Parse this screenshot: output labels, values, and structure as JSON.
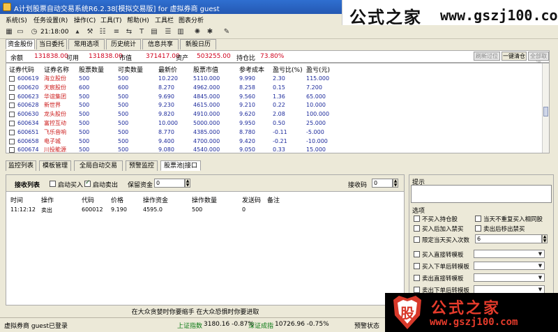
{
  "window": {
    "title": "A计划股票自动交易系统R6.2.38[模拟交易版] for 虚拟券商 guest"
  },
  "watermark_top": {
    "zh": "公式之家",
    "url": "www.gszj100.com"
  },
  "menu": [
    "系统(S)",
    "任务设置(R)",
    "操作(C)",
    "工具(T)",
    "帮助(H)",
    "工具栏",
    "图表分析"
  ],
  "toolbar": {
    "time": "21:18:00"
  },
  "tabs_top": [
    "资金股份",
    "当日委托",
    "常用选项",
    "历史统计",
    "信息共享",
    "新股日历"
  ],
  "summary": {
    "balance_label": "余额",
    "balance": "131838.00",
    "available_label": "可用",
    "available": "131838.00",
    "market_value_label": "市值",
    "market_value": "371417.00",
    "assets_label": "资产",
    "assets": "503255.00",
    "position_ratio_label": "持仓比",
    "position_ratio": "73.80%",
    "btn_refresh": "刷新过位",
    "btn_clear": "一键清仓",
    "btn_select_all": "全部取消"
  },
  "stock_table": {
    "headers": [
      "证券代码",
      "证券名称",
      "股票数量",
      "可卖数量",
      "最新价",
      "股票市值",
      "参考成本",
      "盈亏比(%)",
      "盈亏(元)"
    ],
    "rows": [
      {
        "code": "600619",
        "name": "海立股份",
        "qty": "500",
        "avail": "500",
        "price": "10.220",
        "mv": "5110.000",
        "cost": "9.990",
        "pct": "2.30",
        "pl": "115.000"
      },
      {
        "code": "600620",
        "name": "天宸股份",
        "qty": "600",
        "avail": "600",
        "price": "8.270",
        "mv": "4962.000",
        "cost": "8.258",
        "pct": "0.15",
        "pl": "7.200"
      },
      {
        "code": "600623",
        "name": "华谊集团",
        "qty": "500",
        "avail": "500",
        "price": "9.690",
        "mv": "4845.000",
        "cost": "9.560",
        "pct": "1.36",
        "pl": "65.000"
      },
      {
        "code": "600628",
        "name": "新世界",
        "qty": "500",
        "avail": "500",
        "price": "9.230",
        "mv": "4615.000",
        "cost": "9.210",
        "pct": "0.22",
        "pl": "10.000"
      },
      {
        "code": "600630",
        "name": "龙头股份",
        "qty": "500",
        "avail": "500",
        "price": "9.820",
        "mv": "4910.000",
        "cost": "9.620",
        "pct": "2.08",
        "pl": "100.000"
      },
      {
        "code": "600634",
        "name": "富控互动",
        "qty": "500",
        "avail": "500",
        "price": "10.000",
        "mv": "5000.000",
        "cost": "9.950",
        "pct": "0.50",
        "pl": "25.000"
      },
      {
        "code": "600651",
        "name": "飞乐音响",
        "qty": "500",
        "avail": "500",
        "price": "8.770",
        "mv": "4385.000",
        "cost": "8.780",
        "pct": "-0.11",
        "pl": "-5.000"
      },
      {
        "code": "600658",
        "name": "电子城",
        "qty": "500",
        "avail": "500",
        "price": "9.400",
        "mv": "4700.000",
        "cost": "9.420",
        "pct": "-0.21",
        "pl": "-10.000"
      },
      {
        "code": "600674",
        "name": "川投能源",
        "qty": "500",
        "avail": "500",
        "price": "9.080",
        "mv": "4540.000",
        "cost": "9.050",
        "pct": "0.33",
        "pl": "15.000"
      }
    ]
  },
  "tabs_mid": [
    "监控列表",
    "模板管理",
    "全局自动交易",
    "预警监控",
    "股票池|接口"
  ],
  "receive": {
    "title": "接收列表",
    "auto_buy": "启动买入",
    "auto_sell": "启动卖出",
    "reserve_label": "保留资金",
    "reserve_value": "0",
    "recv_code_label": "接收码",
    "recv_code_value": "0",
    "headers": [
      "时间",
      "操作",
      "代码",
      "价格",
      "操作资金",
      "操作数量",
      "发送码",
      "备注"
    ],
    "row": {
      "time": "11:12:12",
      "op": "卖出",
      "code": "600012",
      "price": "9.190",
      "fund": "4595.0",
      "qty": "500",
      "send": "0",
      "note": ""
    }
  },
  "tips": {
    "title": "提示",
    "options_title": "选项",
    "opt_no_buy_held": "不买入持仓股",
    "opt_no_repeat": "当天不重复买入相同股",
    "opt_forbid_after_buy": "买入后加入禁买",
    "opt_forbid_after_sell": "卖出后移出禁买",
    "opt_limit_label": "限定当天买入次数",
    "opt_limit_value": "6",
    "opt_buy_template": "买入直接转模板",
    "opt_buy_after_order": "买入下单后转模板",
    "opt_sell_template": "卖出直接转模板",
    "opt_sell_after_order": "卖出下单后转模板"
  },
  "marquee": "在大众贪婪时你要缩手 在大众恐惧时你要进取",
  "status": {
    "broker": "虚拟券商 guest已登录",
    "sh_label": "上证指数",
    "sh_value": "3180.16 -0.87%",
    "sz_label": "深证成指",
    "sz_value": "10726.96 -0.75%",
    "warn_label": "预警状态"
  },
  "watermark_bottom": {
    "zh": "公式之家",
    "url": "www.gszj100.com",
    "badge": "股"
  }
}
